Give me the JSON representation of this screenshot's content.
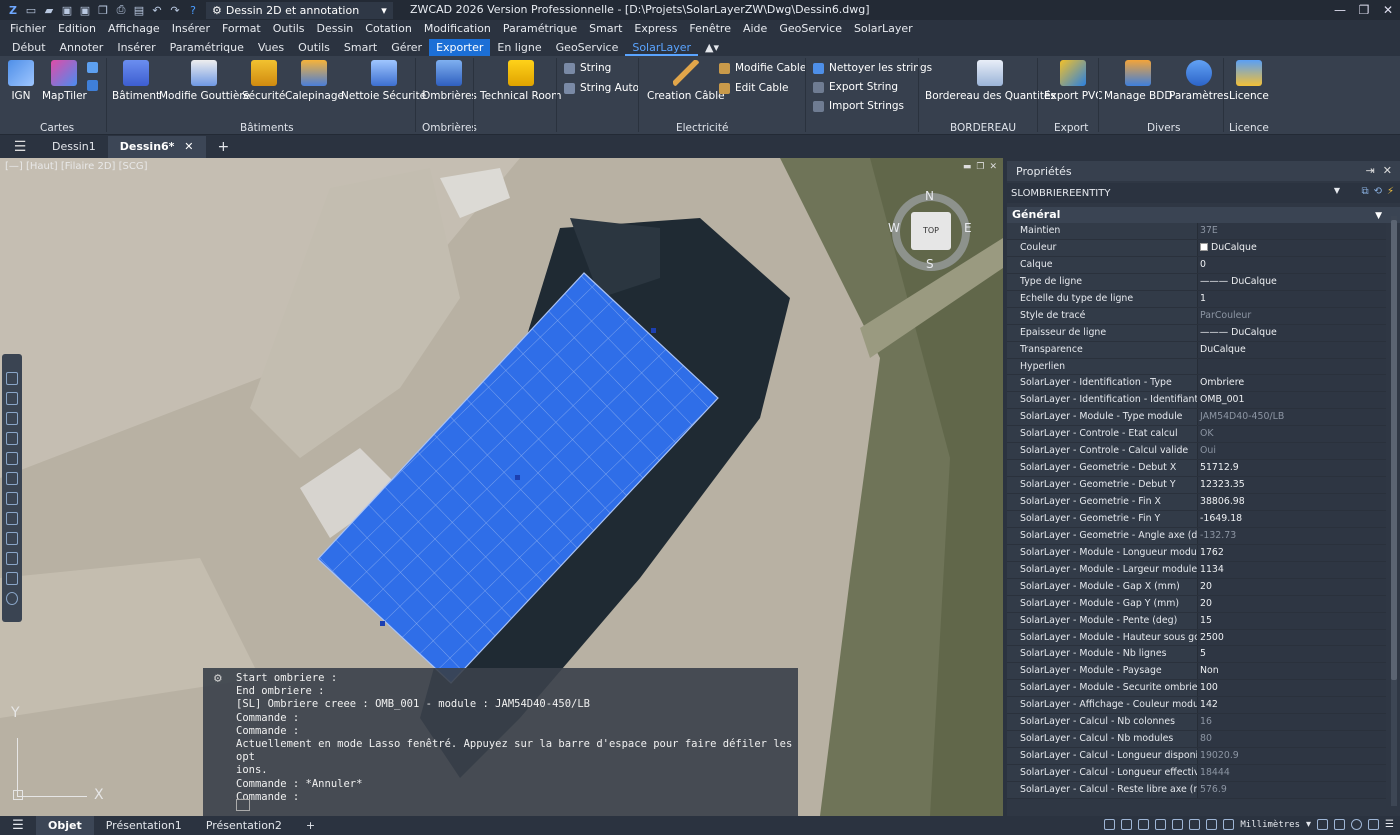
{
  "titlebar": {
    "workspace": "Dessin 2D et annotation",
    "title": "ZWCAD 2026 Version Professionnelle - [D:\\Projets\\SolarLayerZW\\Dwg\\Dessin6.dwg]"
  },
  "menu": [
    "Fichier",
    "Edition",
    "Affichage",
    "Insérer",
    "Format",
    "Outils",
    "Dessin",
    "Cotation",
    "Modification",
    "Paramétrique",
    "Smart",
    "Express",
    "Fenêtre",
    "Aide",
    "GeoService",
    "SolarLayer"
  ],
  "ribbon_tabs": [
    "Début",
    "Annoter",
    "Insérer",
    "Paramétrique",
    "Vues",
    "Outils",
    "Smart",
    "Gérer",
    "Exporter",
    "En ligne",
    "GeoService",
    "SolarLayer"
  ],
  "ribbon": {
    "IGN": "IGN",
    "MapTiler": "MapTiler",
    "cartes": "Cartes",
    "batiment": "Bâtiment",
    "modif_gouttiere": "Modifie Gouttière",
    "securite": "Sécurité",
    "calepinage": "Calepinage",
    "nettoie_securite": "Nettoie Sécurité",
    "batiments": "Bâtiments",
    "ombrieres_btn": "Ombrières",
    "ombrieres": "Ombrières",
    "technical_room": "Technical Room",
    "string": "String",
    "string_auto": "String Auto",
    "creation_cable": "Creation Câble",
    "modifie_cable": "Modifie Cable",
    "edit_cable": "Edit Cable",
    "electricite": "Electricité",
    "nettoyer_strings": "Nettoyer les strings",
    "export_string": "Export String",
    "import_strings": "Import Strings",
    "bordereau_qte": "Bordereau des Quantités",
    "bordereau": "BORDEREAU",
    "export_pvc": "Export PVC",
    "export": "Export",
    "manage_bdd": "Manage BDD",
    "parametres": "Paramètres",
    "divers": "Divers",
    "licence_btn": "Licence",
    "licence": "Licence"
  },
  "doctabs": [
    "Dessin1",
    "Dessin6*"
  ],
  "viewport": {
    "label": "[—] [Haut] [Filaire 2D] [SCG]",
    "compass": {
      "N": "N",
      "S": "S",
      "E": "E",
      "W": "W",
      "top": "TOP"
    },
    "axis_x": "X",
    "axis_y": "Y"
  },
  "command": [
    "Start ombriere :",
    "End ombriere :",
    "[SL] Ombriere creee : OMB_001 - module : JAM54D40-450/LB",
    "Commande :",
    "Commande :",
    "Actuellement en mode Lasso fenêtré. Appuyez sur la barre d'espace pour faire défiler les opt",
    "ions.",
    "Commande : *Annuler*",
    "Commande :"
  ],
  "panel": {
    "title": "Propriétés",
    "entity": "SLOMBRIEREENTITY",
    "group": "Général"
  },
  "properties": [
    {
      "k": "Maintien",
      "v": "37E",
      "ro": true
    },
    {
      "k": "Couleur",
      "v": "DuCalque",
      "swatch": "#ffffff"
    },
    {
      "k": "Calque",
      "v": "0"
    },
    {
      "k": "Type de ligne",
      "v": "——— DuCalque"
    },
    {
      "k": "Echelle du type de ligne",
      "v": "1"
    },
    {
      "k": "Style de tracé",
      "v": "ParCouleur",
      "ro": true
    },
    {
      "k": "Epaisseur de ligne",
      "v": "——— DuCalque"
    },
    {
      "k": "Transparence",
      "v": "DuCalque"
    },
    {
      "k": "Hyperlien",
      "v": ""
    },
    {
      "k": "SolarLayer - Identification - Type",
      "v": "Ombriere"
    },
    {
      "k": "SolarLayer - Identification - Identifiant",
      "v": "OMB_001"
    },
    {
      "k": "SolarLayer - Module - Type module",
      "v": "JAM54D40-450/LB",
      "ro": true
    },
    {
      "k": "SolarLayer - Controle - Etat calcul",
      "v": "OK",
      "ro": true
    },
    {
      "k": "SolarLayer - Controle - Calcul valide",
      "v": "Oui",
      "ro": true
    },
    {
      "k": "SolarLayer - Geometrie - Debut X",
      "v": "51712.9"
    },
    {
      "k": "SolarLayer - Geometrie - Debut Y",
      "v": "12323.35"
    },
    {
      "k": "SolarLayer - Geometrie - Fin X",
      "v": "38806.98"
    },
    {
      "k": "SolarLayer - Geometrie - Fin Y",
      "v": "-1649.18"
    },
    {
      "k": "SolarLayer - Geometrie - Angle axe (deg)",
      "v": "-132.73",
      "ro": true
    },
    {
      "k": "SolarLayer - Module - Longueur module (mm)",
      "v": "1762"
    },
    {
      "k": "SolarLayer - Module - Largeur module (mm)",
      "v": "1134"
    },
    {
      "k": "SolarLayer - Module - Gap X (mm)",
      "v": "20"
    },
    {
      "k": "SolarLayer - Module - Gap Y (mm)",
      "v": "20"
    },
    {
      "k": "SolarLayer - Module - Pente (deg)",
      "v": "15"
    },
    {
      "k": "SolarLayer - Module - Hauteur sous gouttiere...",
      "v": "2500"
    },
    {
      "k": "SolarLayer - Module - Nb lignes",
      "v": "5"
    },
    {
      "k": "SolarLayer - Module - Paysage",
      "v": "Non"
    },
    {
      "k": "SolarLayer - Module - Securite ombriere (mm)",
      "v": "100"
    },
    {
      "k": "SolarLayer - Affichage - Couleur module (ACI)",
      "v": "142"
    },
    {
      "k": "SolarLayer - Calcul - Nb colonnes",
      "v": "16",
      "ro": true
    },
    {
      "k": "SolarLayer - Calcul - Nb modules",
      "v": "80",
      "ro": true
    },
    {
      "k": "SolarLayer - Calcul - Longueur disponible (m...",
      "v": "19020.9",
      "ro": true
    },
    {
      "k": "SolarLayer - Calcul - Longueur effective (mm)",
      "v": "18444",
      "ro": true
    },
    {
      "k": "SolarLayer - Calcul - Reste libre axe (mm)",
      "v": "576.9",
      "ro": true
    }
  ],
  "layouts": [
    "Objet",
    "Présentation1",
    "Présentation2"
  ],
  "status": {
    "units": "Millimètres"
  }
}
